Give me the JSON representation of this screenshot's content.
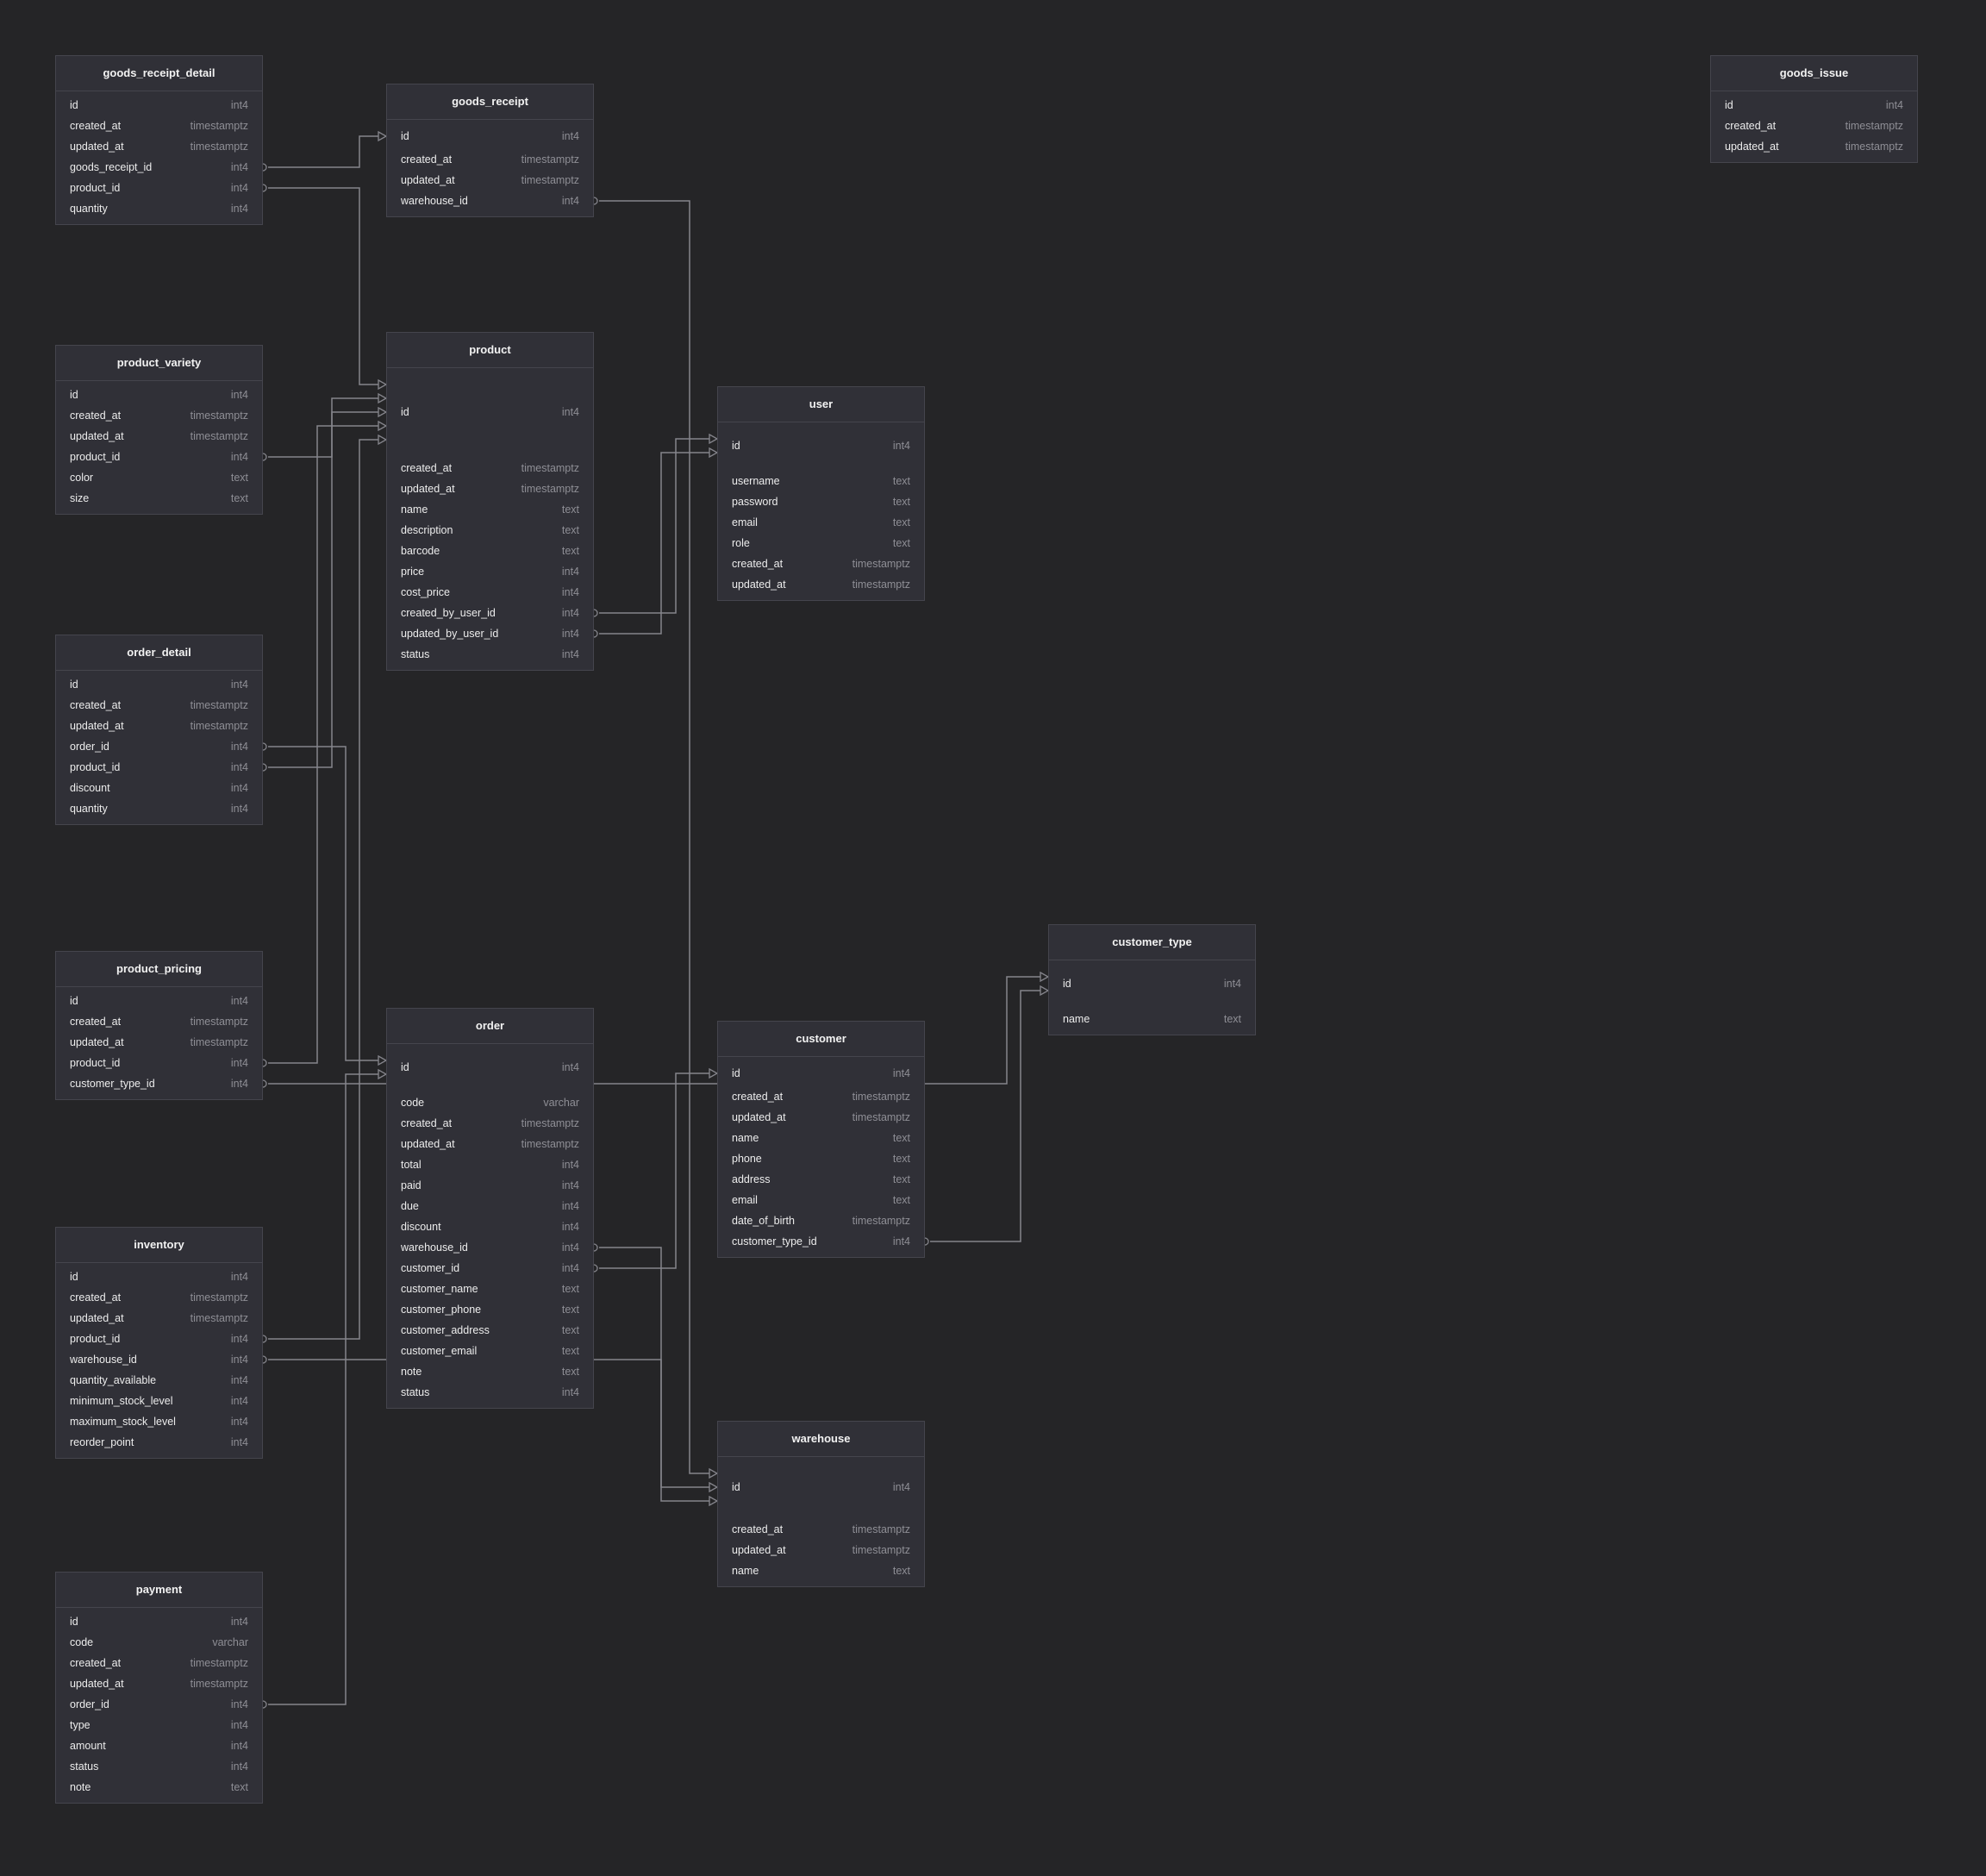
{
  "tables": [
    {
      "name": "goods_receipt_detail",
      "columns": [
        [
          "id",
          "int4"
        ],
        [
          "created_at",
          "timestamptz"
        ],
        [
          "updated_at",
          "timestamptz"
        ],
        [
          "goods_receipt_id",
          "int4"
        ],
        [
          "product_id",
          "int4"
        ],
        [
          "quantity",
          "int4"
        ]
      ]
    },
    {
      "name": "goods_receipt",
      "columns": [
        [
          "id",
          "int4"
        ],
        [
          "created_at",
          "timestamptz"
        ],
        [
          "updated_at",
          "timestamptz"
        ],
        [
          "warehouse_id",
          "int4"
        ]
      ]
    },
    {
      "name": "goods_issue",
      "columns": [
        [
          "id",
          "int4"
        ],
        [
          "created_at",
          "timestamptz"
        ],
        [
          "updated_at",
          "timestamptz"
        ]
      ]
    },
    {
      "name": "product_variety",
      "columns": [
        [
          "id",
          "int4"
        ],
        [
          "created_at",
          "timestamptz"
        ],
        [
          "updated_at",
          "timestamptz"
        ],
        [
          "product_id",
          "int4"
        ],
        [
          "color",
          "text"
        ],
        [
          "size",
          "text"
        ]
      ]
    },
    {
      "name": "product",
      "columns": [
        [
          "id",
          "int4"
        ],
        [
          "created_at",
          "timestamptz"
        ],
        [
          "updated_at",
          "timestamptz"
        ],
        [
          "name",
          "text"
        ],
        [
          "description",
          "text"
        ],
        [
          "barcode",
          "text"
        ],
        [
          "price",
          "int4"
        ],
        [
          "cost_price",
          "int4"
        ],
        [
          "created_by_user_id",
          "int4"
        ],
        [
          "updated_by_user_id",
          "int4"
        ],
        [
          "status",
          "int4"
        ]
      ]
    },
    {
      "name": "user",
      "columns": [
        [
          "id",
          "int4"
        ],
        [
          "username",
          "text"
        ],
        [
          "password",
          "text"
        ],
        [
          "email",
          "text"
        ],
        [
          "role",
          "text"
        ],
        [
          "created_at",
          "timestamptz"
        ],
        [
          "updated_at",
          "timestamptz"
        ]
      ]
    },
    {
      "name": "order_detail",
      "columns": [
        [
          "id",
          "int4"
        ],
        [
          "created_at",
          "timestamptz"
        ],
        [
          "updated_at",
          "timestamptz"
        ],
        [
          "order_id",
          "int4"
        ],
        [
          "product_id",
          "int4"
        ],
        [
          "discount",
          "int4"
        ],
        [
          "quantity",
          "int4"
        ]
      ]
    },
    {
      "name": "customer_type",
      "columns": [
        [
          "id",
          "int4"
        ],
        [
          "name",
          "text"
        ]
      ]
    },
    {
      "name": "product_pricing",
      "columns": [
        [
          "id",
          "int4"
        ],
        [
          "created_at",
          "timestamptz"
        ],
        [
          "updated_at",
          "timestamptz"
        ],
        [
          "product_id",
          "int4"
        ],
        [
          "customer_type_id",
          "int4"
        ]
      ]
    },
    {
      "name": "order",
      "columns": [
        [
          "id",
          "int4"
        ],
        [
          "code",
          "varchar"
        ],
        [
          "created_at",
          "timestamptz"
        ],
        [
          "updated_at",
          "timestamptz"
        ],
        [
          "total",
          "int4"
        ],
        [
          "paid",
          "int4"
        ],
        [
          "due",
          "int4"
        ],
        [
          "discount",
          "int4"
        ],
        [
          "warehouse_id",
          "int4"
        ],
        [
          "customer_id",
          "int4"
        ],
        [
          "customer_name",
          "text"
        ],
        [
          "customer_phone",
          "text"
        ],
        [
          "customer_address",
          "text"
        ],
        [
          "customer_email",
          "text"
        ],
        [
          "note",
          "text"
        ],
        [
          "status",
          "int4"
        ]
      ]
    },
    {
      "name": "customer",
      "columns": [
        [
          "id",
          "int4"
        ],
        [
          "created_at",
          "timestamptz"
        ],
        [
          "updated_at",
          "timestamptz"
        ],
        [
          "name",
          "text"
        ],
        [
          "phone",
          "text"
        ],
        [
          "address",
          "text"
        ],
        [
          "email",
          "text"
        ],
        [
          "date_of_birth",
          "timestamptz"
        ],
        [
          "customer_type_id",
          "int4"
        ]
      ]
    },
    {
      "name": "inventory",
      "columns": [
        [
          "id",
          "int4"
        ],
        [
          "created_at",
          "timestamptz"
        ],
        [
          "updated_at",
          "timestamptz"
        ],
        [
          "product_id",
          "int4"
        ],
        [
          "warehouse_id",
          "int4"
        ],
        [
          "quantity_available",
          "int4"
        ],
        [
          "minimum_stock_level",
          "int4"
        ],
        [
          "maximum_stock_level",
          "int4"
        ],
        [
          "reorder_point",
          "int4"
        ]
      ]
    },
    {
      "name": "warehouse",
      "columns": [
        [
          "id",
          "int4"
        ],
        [
          "created_at",
          "timestamptz"
        ],
        [
          "updated_at",
          "timestamptz"
        ],
        [
          "name",
          "text"
        ]
      ]
    },
    {
      "name": "payment",
      "columns": [
        [
          "id",
          "int4"
        ],
        [
          "code",
          "varchar"
        ],
        [
          "created_at",
          "timestamptz"
        ],
        [
          "updated_at",
          "timestamptz"
        ],
        [
          "order_id",
          "int4"
        ],
        [
          "type",
          "int4"
        ],
        [
          "amount",
          "int4"
        ],
        [
          "status",
          "int4"
        ],
        [
          "note",
          "text"
        ]
      ]
    }
  ],
  "relations": [
    {
      "from": "goods_receipt_detail.goods_receipt_id",
      "to": "goods_receipt.id"
    },
    {
      "from": "goods_receipt_detail.product_id",
      "to": "product.id"
    },
    {
      "from": "goods_receipt.warehouse_id",
      "to": "warehouse.id"
    },
    {
      "from": "product_variety.product_id",
      "to": "product.id"
    },
    {
      "from": "product.created_by_user_id",
      "to": "user.id"
    },
    {
      "from": "product.updated_by_user_id",
      "to": "user.id"
    },
    {
      "from": "order_detail.order_id",
      "to": "order.id"
    },
    {
      "from": "order_detail.product_id",
      "to": "product.id"
    },
    {
      "from": "product_pricing.product_id",
      "to": "product.id"
    },
    {
      "from": "product_pricing.customer_type_id",
      "to": "customer_type.id"
    },
    {
      "from": "inventory.product_id",
      "to": "product.id"
    },
    {
      "from": "inventory.warehouse_id",
      "to": "warehouse.id"
    },
    {
      "from": "order.warehouse_id",
      "to": "warehouse.id"
    },
    {
      "from": "order.customer_id",
      "to": "customer.id"
    },
    {
      "from": "customer.customer_type_id",
      "to": "customer_type.id"
    },
    {
      "from": "payment.order_id",
      "to": "order.id"
    }
  ],
  "colors": {
    "background": "#252527",
    "table": "#303037",
    "border": "#45454d",
    "line": "#85858c"
  }
}
